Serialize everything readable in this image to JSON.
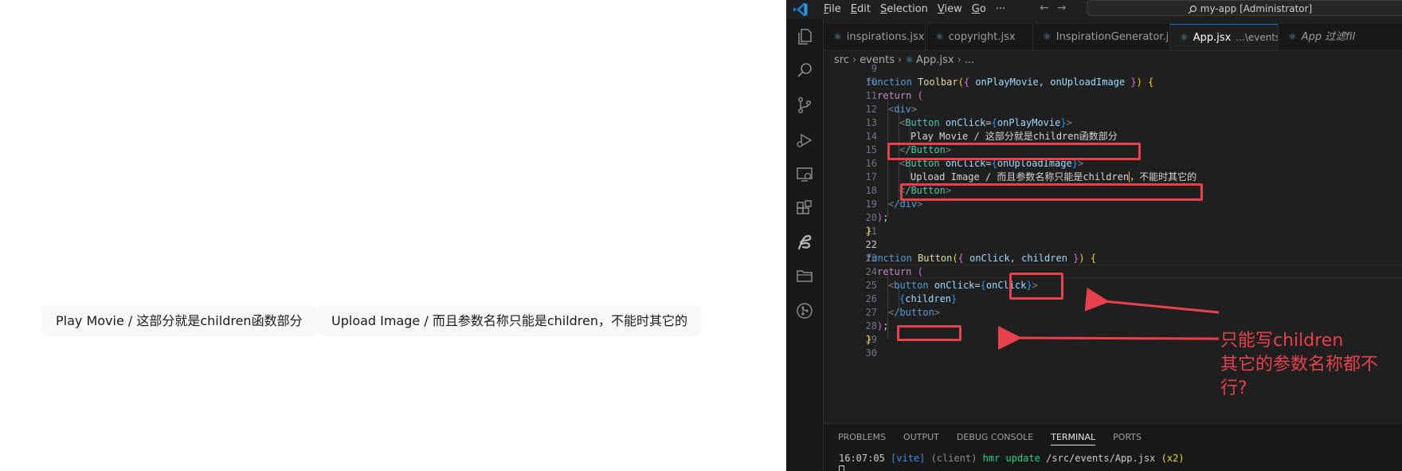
{
  "preview": {
    "buttons": [
      {
        "label": "Play Movie / 这部分就是children函数部分"
      },
      {
        "label": "Upload Image / 而且参数名称只能是children，不能时其它的"
      }
    ]
  },
  "vscode": {
    "menu": [
      "File",
      "Edit",
      "Selection",
      "View",
      "Go",
      "···"
    ],
    "command_center": "my-app [Administrator]",
    "tabs": [
      {
        "name": "inspirations.jsx"
      },
      {
        "name": "copyright.jsx"
      },
      {
        "name": "InspirationGenerator.jsx"
      },
      {
        "name": "App.jsx",
        "dir": "...\\events",
        "active": true
      },
      {
        "name": "App 过滤fil"
      }
    ],
    "breadcrumb": [
      "src",
      "events",
      "App.jsx",
      "..."
    ],
    "line_numbers": [
      "9",
      "10",
      "11",
      "12",
      "13",
      "14",
      "15",
      "16",
      "17",
      "18",
      "19",
      "20",
      "21",
      "22",
      "23",
      "24",
      "25",
      "26",
      "27",
      "28",
      "29",
      "30"
    ],
    "code": {
      "l10_kw": "function",
      "l10_name": "Toolbar",
      "l10_p1": "onPlayMovie",
      "l10_p2": "onUploadImage",
      "return": "return",
      "div_open": "div",
      "div_close": "/div",
      "button_tag": "Button",
      "button_close": "/Button",
      "onclick_attr": "onClick",
      "play_handler": "onPlayMovie",
      "upload_handler": "onUploadImage",
      "play_text": "Play Movie / 这部分就是children函数部分",
      "upload_text_a": "Upload Image / 而且参数名称只能是children",
      "upload_text_b": "，不能时其它的",
      "l23_name": "Button",
      "l23_p1": "onClick",
      "l23_p2": "children",
      "lower_button": "button",
      "lower_button_close": "/button",
      "children_expr": "children"
    },
    "panel": {
      "tabs": [
        "PROBLEMS",
        "OUTPUT",
        "DEBUG CONSOLE",
        "TERMINAL",
        "PORTS"
      ],
      "active_tab": "TERMINAL",
      "terminal": {
        "time": "16:07:05",
        "tag": "[vite]",
        "client": "(client)",
        "action": "hmr update",
        "path": "/src/events/App.jsx",
        "count": "(x2)"
      }
    }
  },
  "annotation": {
    "lines": [
      "只能写children",
      "其它的参数名称都不",
      "行?"
    ],
    "color": "#e8414c"
  }
}
